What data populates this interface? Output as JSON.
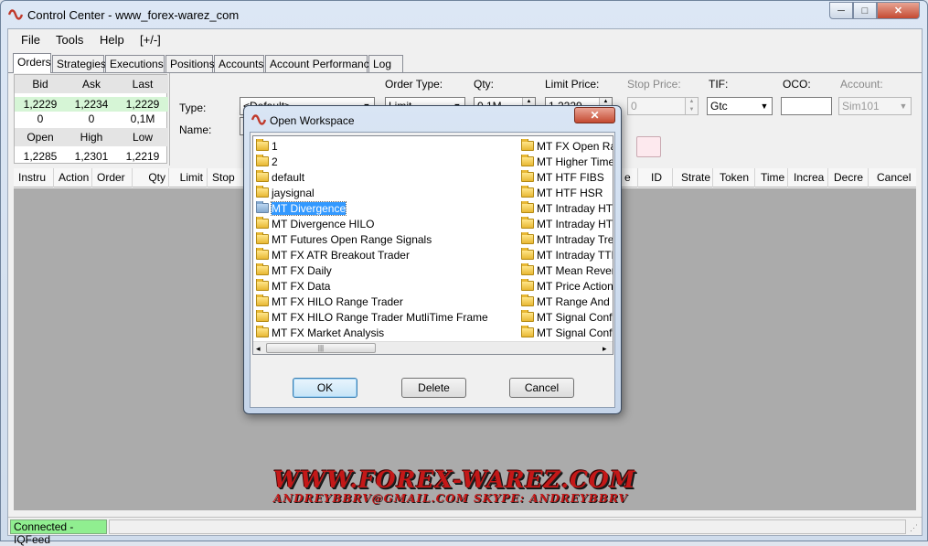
{
  "window": {
    "title": "Control Center - www_forex-warez_com",
    "controls": {
      "minimize": "─",
      "maximize": "□",
      "close": "✕"
    }
  },
  "menu": [
    "File",
    "Tools",
    "Help",
    "[+/-]"
  ],
  "tabs": [
    "Orders",
    "Strategies",
    "Executions",
    "Positions",
    "Accounts",
    "Account Performance",
    "Log"
  ],
  "quote": {
    "headers1": [
      "Bid",
      "Ask",
      "Last"
    ],
    "row1": [
      "1,2229",
      "1,2234",
      "1,2229"
    ],
    "row2": [
      "0",
      "0",
      "0,1M"
    ],
    "headers2": [
      "Open",
      "High",
      "Low"
    ],
    "row3": [
      "1,2285",
      "1,2301",
      "1,2219"
    ]
  },
  "order_entry": {
    "type_label": "Type:",
    "name_label": "Name:",
    "type_value": "<Default>",
    "order_type_label": "Order Type:",
    "order_type_value": "Limit",
    "qty_label": "Qty:",
    "qty_value": "0,1M",
    "limit_price_label": "Limit Price:",
    "limit_price_value": "1,2229",
    "stop_price_label": "Stop Price:",
    "stop_price_value": "0",
    "tif_label": "TIF:",
    "tif_value": "Gtc",
    "oco_label": "OCO:",
    "oco_value": "",
    "account_label": "Account:",
    "account_value": "Sim101"
  },
  "grid_columns": [
    "Instru",
    "Action",
    "Order",
    "Qty",
    "Limit",
    "Stop",
    "e",
    "ID",
    "Strate",
    "Token",
    "Time",
    "Increa",
    "Decre",
    "Cancel"
  ],
  "watermark": {
    "main": "WWW.FOREX-WAREZ.COM",
    "sub": "ANDREYBBRV@GMAIL.COM   SKYPE: ANDREYBBRV"
  },
  "status": {
    "connection": "Connected - IQFeed"
  },
  "dialog": {
    "title": "Open Workspace",
    "close": "✕",
    "selected": "MT Divergence",
    "col1": [
      "1",
      "2",
      "default",
      "jaysignal",
      "MT Divergence",
      "MT Divergence HILO",
      "MT Futures Open Range Signals",
      "MT FX ATR Breakout Trader",
      "MT FX Daily",
      "MT FX Data",
      "MT FX HILO Range Trader",
      "MT FX HILO Range Trader MutliTime Frame",
      "MT FX Market Analysis"
    ],
    "col2": [
      "MT FX Open Rang",
      "MT Higher Time Fr",
      "MT HTF FIBS",
      "MT HTF HSR",
      "MT Intraday HTF L",
      "MT Intraday HTF L",
      "MT Intraday Trend",
      "MT Intraday TTF F",
      "MT Mean Reversio",
      "MT Price Action El",
      "MT Range And Tre",
      "MT Signal Conflue",
      "MT Signal Conflue"
    ],
    "scroll": {
      "left": "◂",
      "right": "▸",
      "thumb": "|||"
    },
    "buttons": {
      "ok": "OK",
      "delete": "Delete",
      "cancel": "Cancel"
    }
  },
  "colors": {
    "selection": "#3399ff",
    "connected": "#90ee90",
    "watermark": "#c41818"
  }
}
